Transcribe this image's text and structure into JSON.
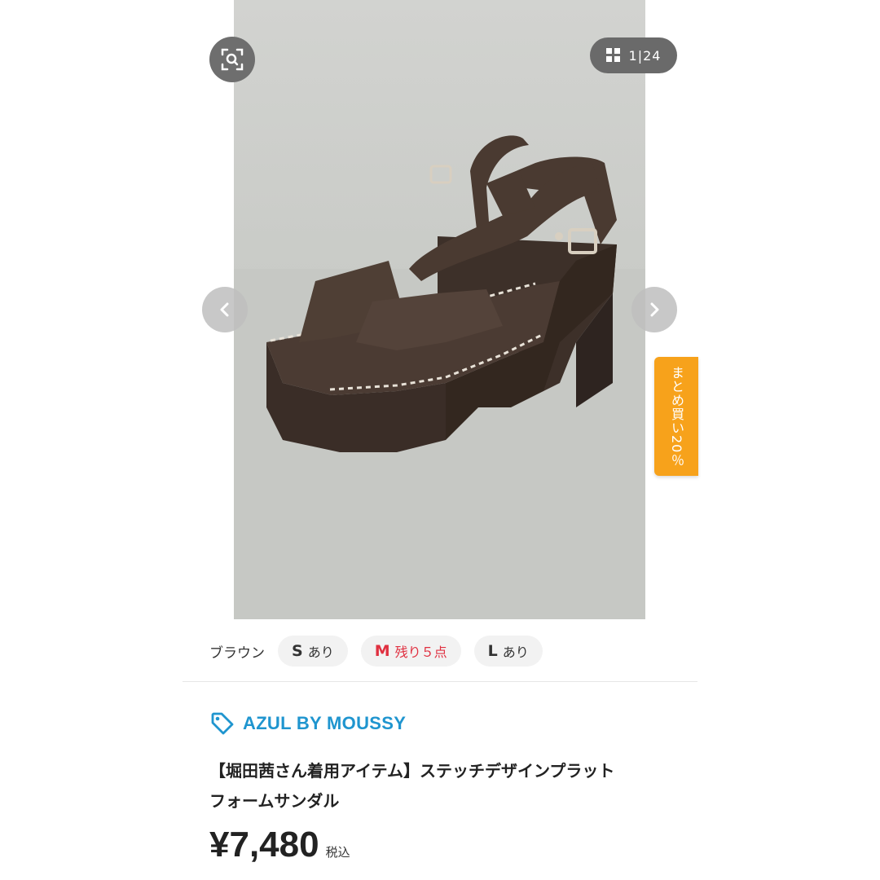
{
  "gallery": {
    "image_alt": "ブラウン platform sandal",
    "counter": {
      "current": "1",
      "separator": "|",
      "total": "24"
    },
    "zoom_icon": "zoom-scan-icon",
    "grid_icon": "grid-icon",
    "prev_icon": "chevron-left-icon",
    "next_icon": "chevron-right-icon",
    "bulk_tab_label": "まとめ買い20％",
    "bulk_tab_color": "#f7a21b"
  },
  "variants": {
    "color": "ブラウン",
    "sizes": [
      {
        "size": "S",
        "status": "あり",
        "low_stock": false
      },
      {
        "size": "M",
        "status": "残り５点",
        "low_stock": true
      },
      {
        "size": "L",
        "status": "あり",
        "low_stock": false
      }
    ],
    "low_stock_color": "#e03040"
  },
  "product": {
    "brand": "AZUL BY MOUSSY",
    "brand_icon": "tag-icon",
    "brand_color": "#1f95cf",
    "title_line1": "【堀田茜さん着用アイテム】ステッチデザインプラット",
    "title_line2": "フォームサンダル",
    "price": "¥7,480",
    "tax_label": "税込"
  }
}
